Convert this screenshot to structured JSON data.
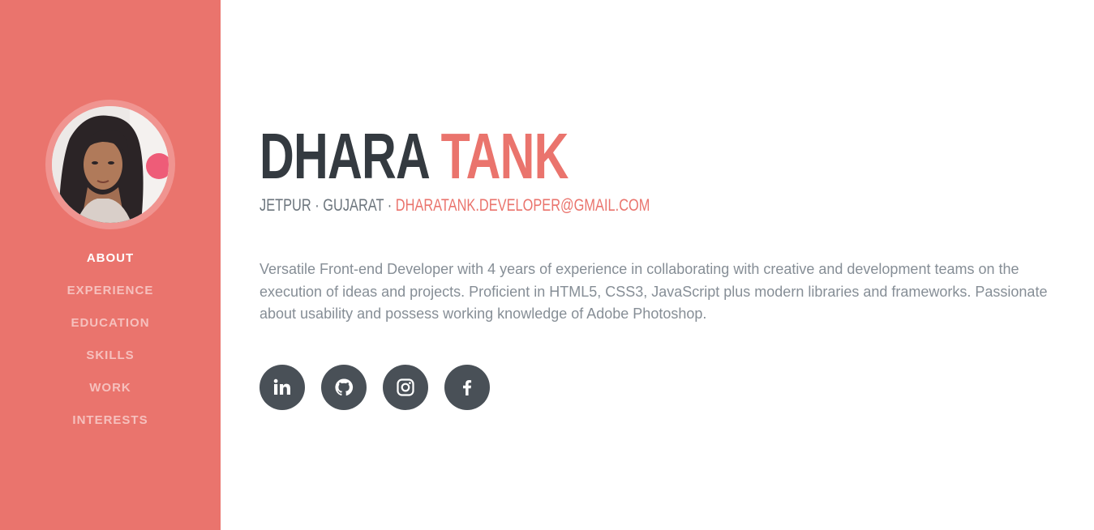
{
  "sidebar": {
    "avatar_alt": "profile photo",
    "nav": [
      {
        "label": "About",
        "active": true
      },
      {
        "label": "Experience",
        "active": false
      },
      {
        "label": "Education",
        "active": false
      },
      {
        "label": "Skills",
        "active": false
      },
      {
        "label": "Work",
        "active": false
      },
      {
        "label": "Interests",
        "active": false
      }
    ]
  },
  "about": {
    "first_name": "Dhara",
    "last_name": "Tank",
    "location": "Jetpur · Gujarat ·",
    "email": "dharatank.developer@gmail.com",
    "summary": "Versatile Front-end Developer with 4 years of experience in collaborating with creative and development teams on the execution of ideas and projects. Proficient in HTML5, CSS3, JavaScript plus modern libraries and frameworks. Passionate about usability and possess working knowledge of Adobe Photoshop."
  },
  "social": [
    {
      "icon": "linkedin-icon"
    },
    {
      "icon": "github-icon"
    },
    {
      "icon": "instagram-icon"
    },
    {
      "icon": "facebook-icon"
    }
  ],
  "colors": {
    "accent": "#ea746d",
    "dark": "#343a40",
    "muted": "#868e96",
    "social_bg": "#495057"
  }
}
